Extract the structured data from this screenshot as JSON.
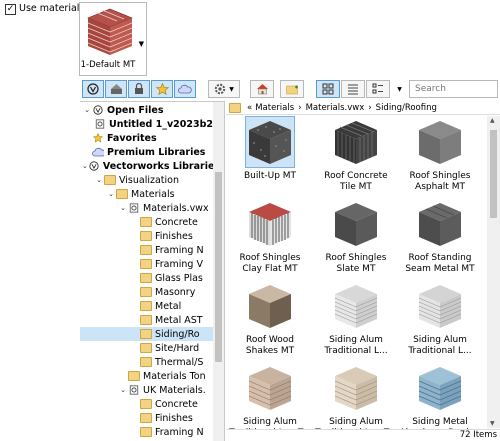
{
  "use_material": {
    "label": "Use material:",
    "checked": "✓"
  },
  "swatch": {
    "label": "1-Default MT"
  },
  "toolbar": {
    "search_placeholder": "Search"
  },
  "tree": {
    "items": [
      {
        "label": "Open Files",
        "bold": true
      },
      {
        "label": "Untitled 1_v2023b2",
        "bold": true
      },
      {
        "label": "Favorites",
        "bold": true
      },
      {
        "label": "Premium Libraries",
        "bold": true
      },
      {
        "label": "Vectorworks Libraries",
        "bold": true
      },
      {
        "label": "Visualization"
      },
      {
        "label": "Materials"
      },
      {
        "label": "Materials.vwx"
      },
      {
        "label": "Concrete"
      },
      {
        "label": "Finishes"
      },
      {
        "label": "Framing N"
      },
      {
        "label": "Framing V"
      },
      {
        "label": "Glass Plas"
      },
      {
        "label": "Masonry"
      },
      {
        "label": "Metal"
      },
      {
        "label": "Metal AST"
      },
      {
        "label": "Siding/Ro"
      },
      {
        "label": "Site/Hard"
      },
      {
        "label": "Thermal/S"
      },
      {
        "label": "Materials Ton"
      },
      {
        "label": "UK Materials."
      },
      {
        "label": "Concrete"
      },
      {
        "label": "Finishes"
      },
      {
        "label": "Framing N"
      }
    ]
  },
  "breadcrumb": {
    "back": "«",
    "sep": "›",
    "items": [
      "Materials",
      "Materials.vwx",
      "Siding/Roofing"
    ]
  },
  "materials": [
    {
      "name": "Built-Up MT"
    },
    {
      "name": "Roof Concrete Tile MT"
    },
    {
      "name": "Roof Shingles Asphalt MT"
    },
    {
      "name": "Roof Shingles Clay Flat MT"
    },
    {
      "name": "Roof Shingles Slate MT"
    },
    {
      "name": "Roof Standing Seam Metal MT"
    },
    {
      "name": "Roof Wood Shakes MT"
    },
    {
      "name": "Siding Alum Traditional L..."
    },
    {
      "name": "Siding Alum Traditional L..."
    },
    {
      "name": "Siding Alum Traditional Lap T..."
    },
    {
      "name": "Siding Alum Traditional Lap T..."
    },
    {
      "name": "Siding Metal Aluminum Doub..."
    }
  ],
  "status": {
    "count": "72 Items"
  }
}
